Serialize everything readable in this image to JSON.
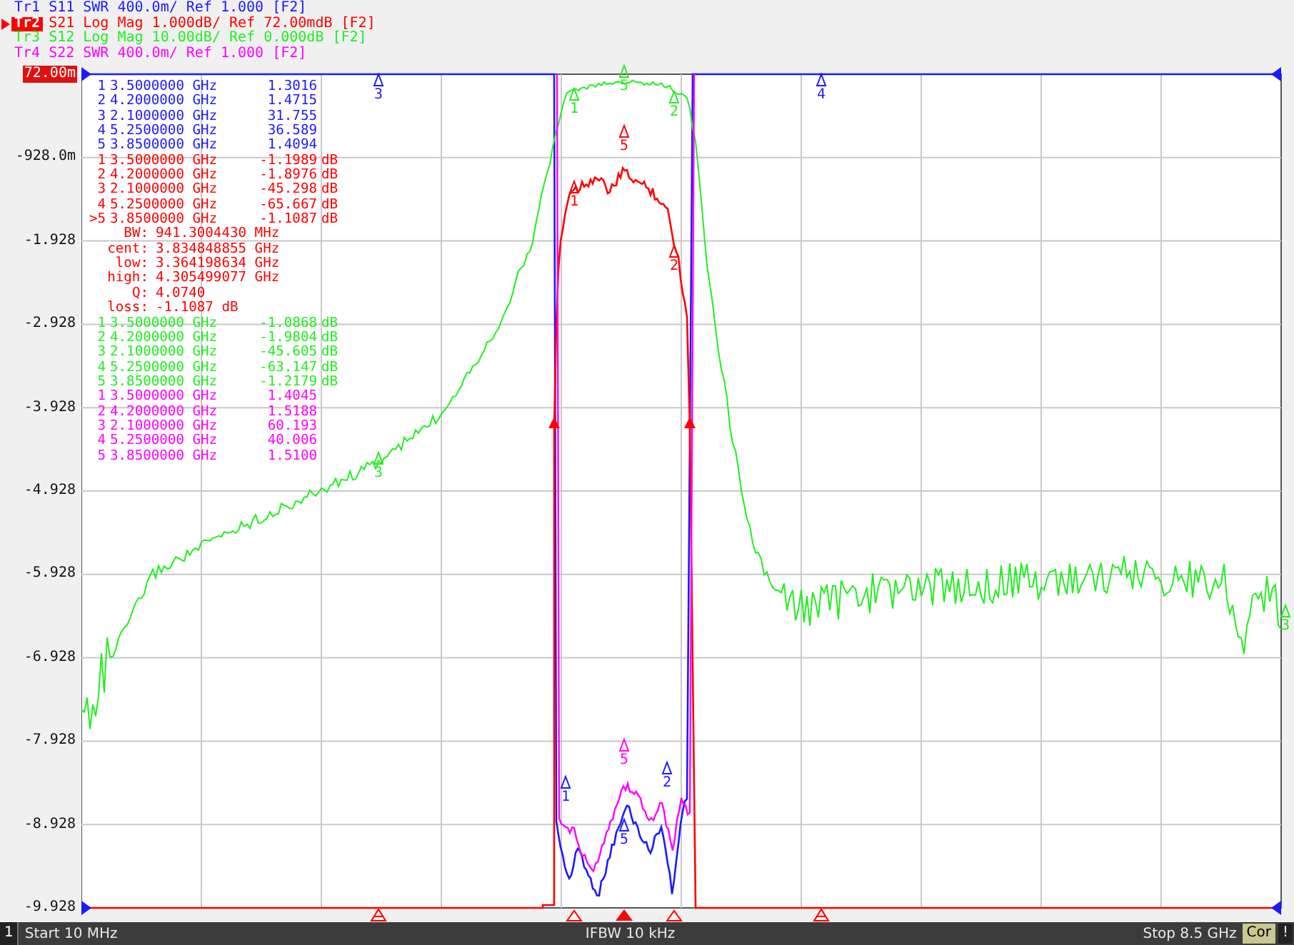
{
  "traces": [
    {
      "name": "Tr1",
      "selected": false,
      "color": "#1a1aff",
      "description": "S11 SWR 400.0m/ Ref 1.000 [F2]",
      "plot_markers": [
        {
          "label": "3"
        },
        {
          "label": "4"
        },
        {
          "label": "1"
        },
        {
          "label": "2"
        },
        {
          "label": "5"
        }
      ]
    },
    {
      "name": "Tr2",
      "selected": true,
      "color": "#ff0000",
      "description": "S21 Log Mag 1.000dB/ Ref 72.00mdB [F2]",
      "plot_markers": [
        {
          "label": "1"
        },
        {
          "label": "2"
        },
        {
          "label": "5"
        }
      ]
    },
    {
      "name": "Tr3",
      "selected": false,
      "color": "#22ee22",
      "description": "S12 Log Mag 10.00dB/ Ref 0.000dB [F2]",
      "plot_markers": [
        {
          "label": "1"
        },
        {
          "label": "2"
        },
        {
          "label": "5"
        },
        {
          "label": "3"
        },
        {
          "label": "3"
        }
      ]
    },
    {
      "name": "Tr4",
      "selected": false,
      "color": "#ff00ff",
      "description": "S22 SWR 400.0m/ Ref 1.000 [F2]",
      "plot_markers": [
        {
          "label": "5"
        }
      ]
    }
  ],
  "y_axis_labels": [
    {
      "text": "72.00m",
      "reference": true
    },
    {
      "text": "-928.0m",
      "reference": false
    },
    {
      "text": "-1.928",
      "reference": false
    },
    {
      "text": "-2.928",
      "reference": false
    },
    {
      "text": "-3.928",
      "reference": false
    },
    {
      "text": "-4.928",
      "reference": false
    },
    {
      "text": "-5.928",
      "reference": false
    },
    {
      "text": "-6.928",
      "reference": false
    },
    {
      "text": "-7.928",
      "reference": false
    },
    {
      "text": "-8.928",
      "reference": false
    },
    {
      "text": "-9.928",
      "reference": false
    }
  ],
  "marker_tables": [
    {
      "color": "#1a1aff",
      "rows": [
        {
          "num": "1",
          "freq": "3.5000000 GHz",
          "value": "1.3016"
        },
        {
          "num": "2",
          "freq": "4.2000000 GHz",
          "value": "1.4715"
        },
        {
          "num": "3",
          "freq": "2.1000000 GHz",
          "value": "31.755"
        },
        {
          "num": "4",
          "freq": "5.2500000 GHz",
          "value": "36.589"
        },
        {
          "num": "5",
          "freq": "3.8500000 GHz",
          "value": "1.4094"
        }
      ]
    },
    {
      "color": "#ff0000",
      "rows": [
        {
          "num": "1",
          "freq": "3.5000000 GHz",
          "value": "-1.1989",
          "unit": "dB"
        },
        {
          "num": "2",
          "freq": "4.2000000 GHz",
          "value": "-1.8976",
          "unit": "dB"
        },
        {
          "num": "3",
          "freq": "2.1000000 GHz",
          "value": "-45.298",
          "unit": "dB"
        },
        {
          "num": "4",
          "freq": "5.2500000 GHz",
          "value": "-65.667",
          "unit": "dB"
        },
        {
          "num": ">5",
          "freq": "3.8500000 GHz",
          "value": "-1.1087",
          "unit": "dB"
        }
      ],
      "stats": [
        {
          "label": "BW:",
          "value": "941.3004430 MHz"
        },
        {
          "label": "cent:",
          "value": "3.834848855 GHz"
        },
        {
          "label": "low:",
          "value": "3.364198634 GHz"
        },
        {
          "label": "high:",
          "value": "4.305499077 GHz"
        },
        {
          "label": "Q:",
          "value": "4.0740"
        },
        {
          "label": "loss:",
          "value": "-1.1087 dB"
        }
      ]
    },
    {
      "color": "#22ee22",
      "rows": [
        {
          "num": "1",
          "freq": "3.5000000 GHz",
          "value": "-1.0868",
          "unit": "dB"
        },
        {
          "num": "2",
          "freq": "4.2000000 GHz",
          "value": "-1.9804",
          "unit": "dB"
        },
        {
          "num": "3",
          "freq": "2.1000000 GHz",
          "value": "-45.605",
          "unit": "dB"
        },
        {
          "num": "4",
          "freq": "5.2500000 GHz",
          "value": "-63.147",
          "unit": "dB"
        },
        {
          "num": "5",
          "freq": "3.8500000 GHz",
          "value": "-1.2179",
          "unit": "dB"
        }
      ]
    },
    {
      "color": "#ff00ff",
      "rows": [
        {
          "num": "1",
          "freq": "3.5000000 GHz",
          "value": "1.4045"
        },
        {
          "num": "2",
          "freq": "4.2000000 GHz",
          "value": "1.5188"
        },
        {
          "num": "3",
          "freq": "2.1000000 GHz",
          "value": "60.193"
        },
        {
          "num": "4",
          "freq": "5.2500000 GHz",
          "value": "40.006"
        },
        {
          "num": "5",
          "freq": "3.8500000 GHz",
          "value": "1.5100"
        }
      ]
    }
  ],
  "status_bar": {
    "channel": "1",
    "start": "Start 10 MHz",
    "ifbw": "IFBW 10 kHz",
    "stop": "Stop 8.5 GHz",
    "correction": "Cor",
    "warning": "!"
  }
}
